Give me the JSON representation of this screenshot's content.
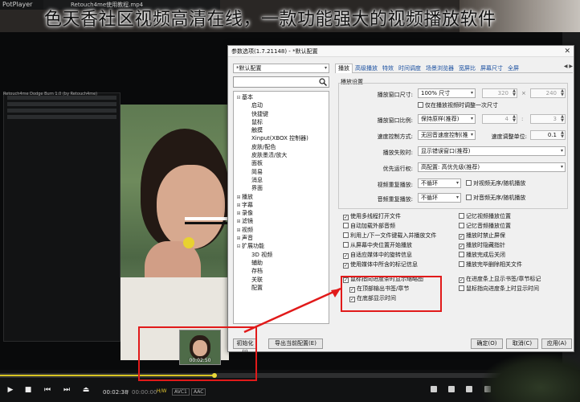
{
  "banner": {
    "text": "色天香社区视频高清在线，一款功能强大的视频播放软件"
  },
  "player": {
    "logo": "PotPlayer",
    "file_tab": "Retouch4me使用教程.mp4",
    "preview_title": "Retouch4me Dodge Burn 1.0 (by Retouch4me)",
    "thumb_time": "00:02:50",
    "current_time": "00:02:38",
    "total_time": "00:00:00",
    "tag_hw": "H/W",
    "tag_codec": "AVC1",
    "tag_audio": "AAC",
    "seek_fraction": 0.37
  },
  "dialog": {
    "title": "参数选项(1.7.21148) - *默认配置",
    "profile": "*默认配置",
    "tree": [
      {
        "label": "基本",
        "exp": "⊟",
        "indent": 0
      },
      {
        "label": "启动",
        "exp": "",
        "indent": 1
      },
      {
        "label": "快捷键",
        "exp": "",
        "indent": 1
      },
      {
        "label": "鼠标",
        "exp": "",
        "indent": 1
      },
      {
        "label": "触摸",
        "exp": "",
        "indent": 1
      },
      {
        "label": "Xinput(XBOX 控制器)",
        "exp": "",
        "indent": 1
      },
      {
        "label": "皮肤/配色",
        "exp": "",
        "indent": 1
      },
      {
        "label": "皮肤墨渍/放大",
        "exp": "",
        "indent": 1
      },
      {
        "label": "面板",
        "exp": "",
        "indent": 1
      },
      {
        "label": "简易",
        "exp": "",
        "indent": 1
      },
      {
        "label": "消息",
        "exp": "",
        "indent": 1
      },
      {
        "label": "界面",
        "exp": "",
        "indent": 1
      },
      {
        "label": "播放",
        "exp": "⊞",
        "indent": 0
      },
      {
        "label": "字幕",
        "exp": "⊞",
        "indent": 0
      },
      {
        "label": "录像",
        "exp": "⊞",
        "indent": 0
      },
      {
        "label": "滤镜",
        "exp": "⊞",
        "indent": 0
      },
      {
        "label": "视频",
        "exp": "⊞",
        "indent": 0
      },
      {
        "label": "声音",
        "exp": "⊞",
        "indent": 0
      },
      {
        "label": "扩展功能",
        "exp": "⊟",
        "indent": 0
      },
      {
        "label": "3D 视频",
        "exp": "",
        "indent": 1
      },
      {
        "label": "辅助",
        "exp": "",
        "indent": 1
      },
      {
        "label": "存档",
        "exp": "",
        "indent": 1
      },
      {
        "label": "关联",
        "exp": "",
        "indent": 1
      },
      {
        "label": "配置",
        "exp": "",
        "indent": 1
      }
    ],
    "tabs": [
      "播放",
      "高级播放",
      "特效",
      "时间调度",
      "场景浏览器",
      "宽屏比",
      "屏幕尺寸",
      "全屏"
    ],
    "group_title": "播放设置",
    "rows": {
      "window_size_label": "播放窗口尺寸:",
      "window_size_value": "100% 尺寸",
      "window_w": "320",
      "window_h": "240",
      "only_at_start": "仅在播放视频时调整一次尺寸",
      "ratio_label": "播放窗口比例:",
      "ratio_value": "保持原样(推荐)",
      "ratio_a": "4",
      "ratio_b": "3",
      "speed_label": "速度控制方式:",
      "speed_value": "无回音速度控制(推",
      "speed_unit_label": "速度调整单位:",
      "speed_unit_value": "0.1",
      "fail_label": "播放失败时:",
      "fail_value": "显示错误窗口(推荐)",
      "priority_label": "优先运行权:",
      "priority_value": "高配置: 高优先级(推荐)",
      "video_repeat_label": "视频重复播放:",
      "video_repeat_value": "不循环",
      "video_random": "对视频无序/随机播放",
      "audio_repeat_label": "音频重复播放:",
      "audio_repeat_value": "不循环",
      "audio_random": "对音频无序/随机播放"
    },
    "checks_left": [
      {
        "label": "使用多线程打开文件",
        "checked": true
      },
      {
        "label": "自动加载外部音频",
        "checked": false
      },
      {
        "label": "利用上/下一文件键载入并播放文件",
        "checked": false
      },
      {
        "label": "从屏幕中央位置开始播放",
        "checked": false
      },
      {
        "label": "自适应媒体中的旋转信息",
        "checked": true
      },
      {
        "label": "使用媒体中所含的标记信息",
        "checked": true
      },
      {
        "label": "鼠标指向进度条时显示缩略图",
        "checked": true
      },
      {
        "label": "在顶部输出书签/章节",
        "checked": true
      },
      {
        "label": "在底部显示时间",
        "checked": true
      }
    ],
    "checks_right": [
      {
        "label": "记忆视频播放位置",
        "checked": false
      },
      {
        "label": "记忆音频播放位置",
        "checked": false
      },
      {
        "label": "播放时禁止屏保",
        "checked": true
      },
      {
        "label": "播放时隐藏指针",
        "checked": true
      },
      {
        "label": "播放完成后关闭",
        "checked": false
      },
      {
        "label": "播放完毕删除相关文件",
        "checked": false
      },
      {
        "label": "在进度条上显示书签/章节标记",
        "checked": true
      },
      {
        "label": "鼠标指向进度条上时显示时间",
        "checked": false
      }
    ],
    "buttons": {
      "init": "初始化(I)",
      "export": "导出当前配置(E)",
      "ok": "确定(O)",
      "cancel": "取消(C)",
      "apply": "应用(A)"
    }
  }
}
